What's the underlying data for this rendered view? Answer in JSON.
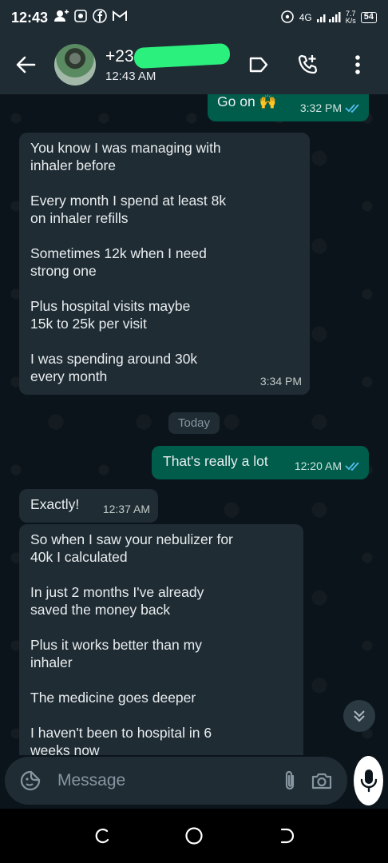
{
  "status_bar": {
    "time": "12:43",
    "network": "4G",
    "speed_value": "7.7",
    "speed_unit": "K/s",
    "battery": "54"
  },
  "header": {
    "contact_name": "+23",
    "contact_status": "12:43 AM"
  },
  "messages": [
    {
      "direction": "outgoing",
      "lines": [
        "Go on 🙌"
      ],
      "time": "3:32 PM",
      "read": true
    },
    {
      "direction": "incoming",
      "lines": [
        "You know I was managing with inhaler before",
        "Every month I spend at least 8k on inhaler refills",
        "Sometimes 12k when I need strong one",
        "Plus hospital visits maybe 15k to 25k per visit",
        "I was spending around 30k every month"
      ],
      "time": "3:34 PM"
    },
    {
      "direction": "date",
      "label": "Today"
    },
    {
      "direction": "outgoing",
      "lines": [
        "That's really a lot"
      ],
      "time": "12:20 AM",
      "read": true
    },
    {
      "direction": "incoming",
      "lines": [
        "Exactly!"
      ],
      "time": "12:37 AM"
    },
    {
      "direction": "incoming",
      "lines": [
        "So when I saw your nebulizer for 40k I calculated",
        "In just 2 months I've already saved the money back",
        "Plus it works better than my inhaler",
        "The medicine goes deeper",
        "I haven't been to hospital in 6 weeks now"
      ],
      "time": ""
    }
  ],
  "composer": {
    "placeholder": "Message"
  },
  "colors": {
    "outgoing_bubble": "#005c4b",
    "incoming_bubble": "#1f2c34",
    "read_ticks": "#53bdeb",
    "background": "#0b141a"
  }
}
